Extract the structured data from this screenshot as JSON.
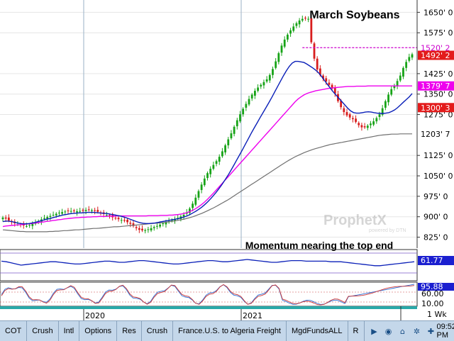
{
  "chart_data": {
    "type": "candlestick",
    "title": "March Soybeans",
    "ylim": [
      790,
      1690
    ],
    "y_ticks": [
      "1650' 0",
      "1575' 0",
      "1425' 0",
      "1350' 0",
      "1275' 0",
      "1125' 0",
      "1050' 0",
      "975' 0",
      "900' 0",
      "825' 0"
    ],
    "y_tick_values": [
      1650,
      1575,
      1425,
      1350,
      1275,
      1125,
      1050,
      975,
      900,
      825
    ],
    "x_labels": [
      "2020",
      "2021"
    ],
    "price_badges": [
      {
        "label": "1520' 2",
        "value": 1520.25,
        "bg": "#ffffff",
        "fg": "#cc00cc"
      },
      {
        "label": "1492' 2",
        "value": 1492.25,
        "bg": "#e31b1b",
        "fg": "#ffffff"
      },
      {
        "label": "1379' 7",
        "value": 1379.9,
        "bg": "#ee00ee",
        "fg": "#ffffff"
      },
      {
        "label": "1300' 3",
        "value": 1300.4,
        "bg": "#e31b1b",
        "fg": "#ffffff"
      },
      {
        "label": "1203' 7",
        "value": 1203.9,
        "bg": "#ffffff",
        "fg": "#000000"
      }
    ],
    "reference_line": {
      "value": 1520.25,
      "color": "#cc00cc"
    },
    "candles_close": [
      897,
      893,
      886,
      880,
      876,
      872,
      870,
      868,
      866,
      870,
      874,
      878,
      884,
      890,
      895,
      899,
      903,
      907,
      911,
      915,
      917,
      919,
      921,
      921,
      920,
      920,
      921,
      923,
      925,
      925,
      924,
      921,
      918,
      914,
      910,
      906,
      902,
      898,
      894,
      891,
      888,
      885,
      880,
      874,
      866,
      858,
      852,
      850,
      851,
      854,
      858,
      862,
      866,
      871,
      876,
      880,
      884,
      888,
      892,
      896,
      901,
      907,
      916,
      930,
      948,
      970,
      994,
      1018,
      1040,
      1060,
      1076,
      1090,
      1104,
      1120,
      1140,
      1162,
      1184,
      1206,
      1230,
      1254,
      1276,
      1296,
      1314,
      1332,
      1348,
      1362,
      1374,
      1384,
      1394,
      1404,
      1420,
      1442,
      1470,
      1500,
      1528,
      1550,
      1568,
      1584,
      1598,
      1610,
      1620,
      1626,
      1628,
      1626,
      1540,
      1480,
      1440,
      1420,
      1406,
      1396,
      1384,
      1370,
      1352,
      1324,
      1302,
      1284,
      1272,
      1264,
      1258,
      1248,
      1236,
      1228,
      1228,
      1234,
      1242,
      1250,
      1262,
      1276,
      1298,
      1324,
      1348,
      1368,
      1382,
      1398,
      1418,
      1446,
      1468,
      1486,
      1496
    ],
    "ma_blue": [
      882,
      884,
      884,
      882,
      880,
      877,
      875,
      874,
      874,
      875,
      877,
      879,
      882,
      885,
      888,
      891,
      893,
      896,
      899,
      902,
      905,
      907,
      909,
      911,
      912,
      913,
      914,
      914,
      915,
      916,
      916,
      916,
      915,
      914,
      913,
      912,
      911,
      909,
      907,
      905,
      903,
      900,
      897,
      893,
      889,
      885,
      881,
      878,
      876,
      875,
      875,
      876,
      877,
      879,
      881,
      883,
      885,
      887,
      889,
      891,
      893,
      896,
      899,
      903,
      908,
      914,
      920,
      927,
      935,
      944,
      954,
      965,
      977,
      990,
      1004,
      1019,
      1035,
      1052,
      1070,
      1089,
      1108,
      1127,
      1147,
      1167,
      1187,
      1207,
      1226,
      1245,
      1264,
      1282,
      1300,
      1319,
      1338,
      1358,
      1378,
      1398,
      1418,
      1436,
      1452,
      1464,
      1470,
      1470,
      1468,
      1466,
      1460,
      1453,
      1446,
      1438,
      1428,
      1415,
      1400,
      1386,
      1372,
      1358,
      1346,
      1334,
      1322,
      1310,
      1298,
      1288,
      1282,
      1280,
      1280,
      1282,
      1284,
      1285,
      1284,
      1282,
      1280,
      1279,
      1279,
      1280,
      1282,
      1286,
      1292,
      1300,
      1310,
      1320,
      1330,
      1340,
      1352
    ],
    "ma_magenta": [
      864,
      866,
      867,
      868,
      869,
      870,
      871,
      872,
      873,
      874,
      875,
      877,
      878,
      880,
      881,
      883,
      884,
      886,
      887,
      889,
      890,
      892,
      893,
      894,
      895,
      896,
      897,
      898,
      898,
      899,
      899,
      900,
      900,
      901,
      901,
      901,
      902,
      902,
      902,
      903,
      903,
      903,
      903,
      903,
      903,
      903,
      903,
      903,
      903,
      903,
      904,
      904,
      904,
      904,
      905,
      905,
      905,
      906,
      906,
      907,
      908,
      910,
      912,
      915,
      919,
      924,
      930,
      937,
      945,
      954,
      964,
      975,
      986,
      998,
      1010,
      1022,
      1034,
      1046,
      1058,
      1070,
      1082,
      1094,
      1106,
      1118,
      1130,
      1142,
      1154,
      1166,
      1178,
      1190,
      1202,
      1214,
      1226,
      1238,
      1250,
      1262,
      1274,
      1286,
      1298,
      1310,
      1322,
      1332,
      1340,
      1347,
      1352,
      1356,
      1359,
      1362,
      1364,
      1366,
      1368,
      1370,
      1372,
      1373,
      1374,
      1375,
      1376,
      1377,
      1378,
      1378,
      1378,
      1379,
      1379,
      1379,
      1379,
      1380,
      1380,
      1380,
      1380,
      1380,
      1380,
      1380,
      1380,
      1380,
      1380,
      1380,
      1380,
      1380,
      1380,
      1380,
      1380
    ],
    "ma_gray": [
      852,
      851,
      850,
      849,
      848,
      847,
      846,
      846,
      845,
      845,
      845,
      845,
      845,
      845,
      845,
      845,
      846,
      846,
      847,
      847,
      848,
      849,
      849,
      850,
      851,
      852,
      852,
      853,
      854,
      855,
      856,
      857,
      857,
      858,
      859,
      860,
      861,
      862,
      863,
      863,
      864,
      865,
      866,
      867,
      868,
      869,
      870,
      871,
      872,
      873,
      874,
      875,
      876,
      877,
      878,
      879,
      880,
      882,
      883,
      885,
      887,
      889,
      891,
      894,
      897,
      900,
      904,
      908,
      912,
      917,
      922,
      927,
      932,
      938,
      944,
      950,
      956,
      962,
      969,
      976,
      983,
      990,
      997,
      1004,
      1011,
      1018,
      1025,
      1032,
      1039,
      1046,
      1053,
      1060,
      1067,
      1074,
      1081,
      1088,
      1095,
      1102,
      1108,
      1114,
      1120,
      1125,
      1130,
      1135,
      1139,
      1143,
      1147,
      1150,
      1153,
      1156,
      1159,
      1162,
      1165,
      1167,
      1169,
      1171,
      1173,
      1175,
      1177,
      1179,
      1181,
      1183,
      1185,
      1187,
      1189,
      1191,
      1193,
      1195,
      1197,
      1199,
      1200,
      1201,
      1202,
      1203,
      1203,
      1203,
      1204,
      1204,
      1204,
      1204,
      1204
    ]
  },
  "momentum": {
    "title": "Momentum nearing the top end",
    "value_badge": "61.77",
    "ylim": [
      30,
      80
    ],
    "series": [
      62,
      61,
      59,
      57,
      55,
      56,
      57,
      58,
      59,
      60,
      61,
      61,
      60,
      59,
      58,
      57,
      57,
      58,
      59,
      60,
      61,
      62,
      62,
      61,
      60,
      60,
      61,
      62,
      63,
      63,
      62,
      61,
      60,
      59,
      58,
      57,
      57,
      58,
      59,
      60,
      61,
      62,
      63,
      63,
      62,
      61,
      61,
      62,
      63,
      64,
      65,
      64,
      63,
      62,
      61,
      60,
      60,
      61,
      62,
      63,
      63,
      63,
      62,
      62,
      62,
      62,
      62,
      61,
      61,
      61,
      60,
      59,
      58,
      57,
      56,
      55,
      54,
      54,
      55,
      56,
      57,
      58,
      59,
      60,
      61
    ]
  },
  "stochastic": {
    "value_badge": "95.88",
    "tick_labels": [
      "60.00",
      "10.00"
    ],
    "tick_values": [
      60,
      10
    ],
    "ylim": [
      0,
      100
    ]
  },
  "timebar": {
    "period_label": "1 Wk"
  },
  "taskbar": {
    "items": [
      "COT",
      "Crush",
      "Intl",
      "Options",
      "Res",
      "Crush",
      "France.U.S. to Algeria Freight",
      "MgdFundsALL",
      "R"
    ],
    "clock": "09:52 PM"
  }
}
